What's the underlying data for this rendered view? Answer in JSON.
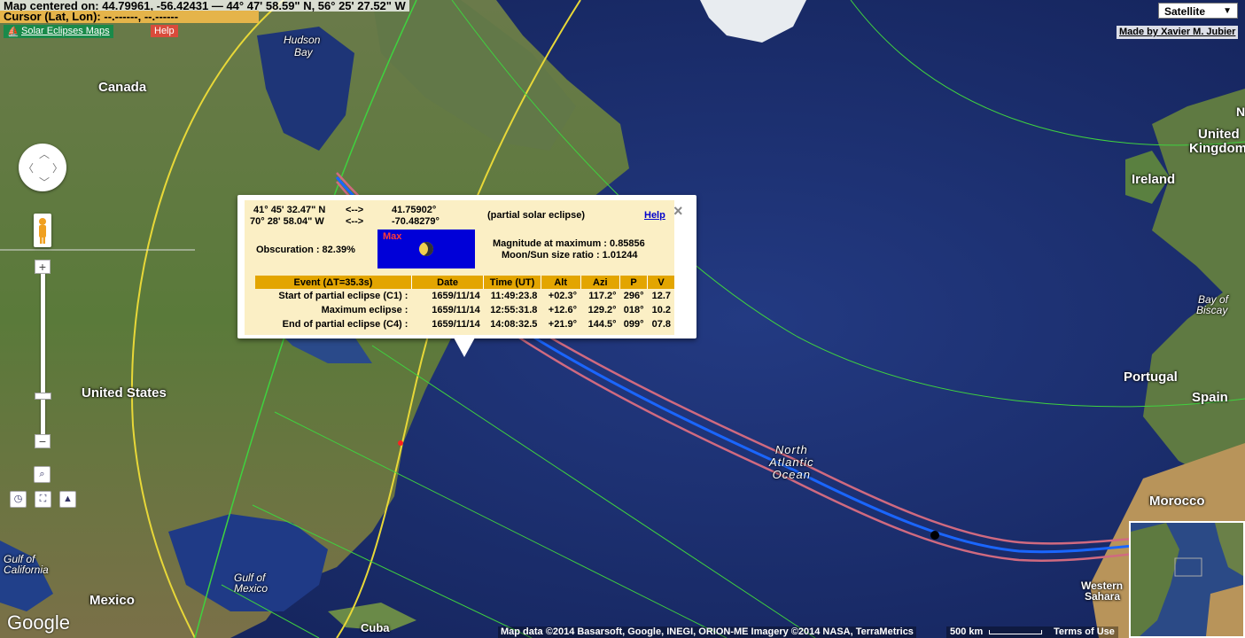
{
  "header": {
    "map_centered": "Map centered on: 44.79961, -56.42431 — 44° 47' 58.59\" N, 56° 25' 27.52\" W",
    "cursor": "Cursor (Lat, Lon): --.------, --.------",
    "link_label": "Solar Eclipses Maps",
    "help_label": "Help"
  },
  "map_type": {
    "selected": "Satellite"
  },
  "credit": "Made by Xavier M. Jubier",
  "labels": {
    "hudson1": "Hudson",
    "hudson2": "Bay",
    "canada": "Canada",
    "united_states": "United States",
    "mexico": "Mexico",
    "gulf_cal1": "Gulf of",
    "gulf_cal2": "California",
    "gulf_mex1": "Gulf of",
    "gulf_mex2": "Mexico",
    "cuba": "Cuba",
    "north": "North",
    "atlantic": "Atlantic",
    "ocean": "Ocean",
    "uk1": "United",
    "uk2": "Kingdom",
    "ireland": "Ireland",
    "bay_biscay1": "Bay of",
    "bay_biscay2": "Biscay",
    "portugal": "Portugal",
    "spain": "Spain",
    "morocco": "Morocco",
    "western_sahara1": "Western",
    "western_sahara2": "Sahara",
    "n_edge": "N"
  },
  "popup": {
    "lat_dms": "41° 45' 32.47\" N",
    "arrow1": "<-->",
    "lat_dec": "41.75902°",
    "lon_dms": "70° 28' 58.04\" W",
    "arrow2": "<-->",
    "lon_dec": "-70.48279°",
    "type": "(partial solar eclipse)",
    "help": "Help",
    "obscuration": "Obscuration : 82.39%",
    "max_label": "Max",
    "magnitude": "Magnitude at maximum : 0.85856",
    "ratio": "Moon/Sun size ratio : 1.01244",
    "table": {
      "headers": [
        "Event (ΔT=35.3s)",
        "Date",
        "Time (UT)",
        "Alt",
        "Azi",
        "P",
        "V"
      ],
      "rows": [
        [
          "Start of partial eclipse (C1) :",
          "1659/11/14",
          "11:49:23.8",
          "+02.3°",
          "117.2°",
          "296°",
          "12.7"
        ],
        [
          "Maximum eclipse :",
          "1659/11/14",
          "12:55:31.8",
          "+12.6°",
          "129.2°",
          "018°",
          "10.2"
        ],
        [
          "End of partial eclipse (C4) :",
          "1659/11/14",
          "14:08:32.5",
          "+21.9°",
          "144.5°",
          "099°",
          "07.8"
        ]
      ]
    }
  },
  "footer": {
    "google": "Google",
    "attribution": "Map data ©2014 Basarsoft, Google, INEGI, ORION-ME Imagery ©2014 NASA, TerraMetrics",
    "scale": "500 km",
    "terms": "Terms of Use"
  },
  "colors": {
    "ocean": "#1c2f6e",
    "land": "#5d7a3a",
    "central_line": "#1a66ff",
    "path_limits": "#d06a80",
    "green_lines": "#3fd23f",
    "yellow_lines": "#e8d838",
    "popup_bg": "#fbefc5",
    "table_header": "#e3a500"
  }
}
